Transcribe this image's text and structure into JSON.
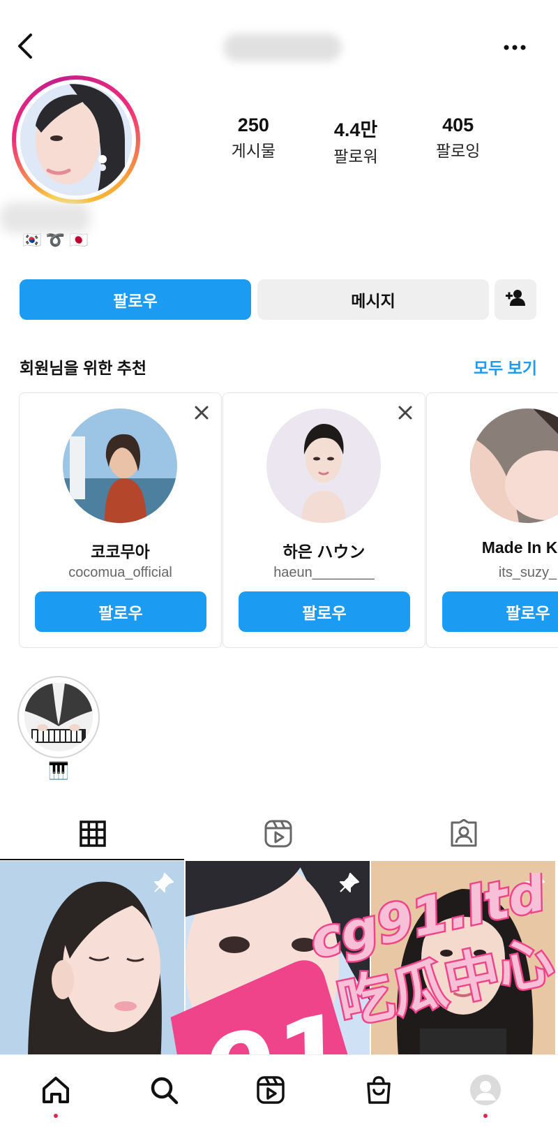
{
  "header": {
    "back_icon": "chevron-left-icon",
    "more_icon": "more-horizontal-icon"
  },
  "profile": {
    "stats": [
      {
        "value": "250",
        "label": "게시물"
      },
      {
        "value": "4.4만",
        "label": "팔로워"
      },
      {
        "value": "405",
        "label": "팔로잉"
      }
    ],
    "bio": "🇰🇷 ➰ 🇯🇵",
    "story_ring_colors": [
      "#f9ce34",
      "#ee2a7b",
      "#c51f8b"
    ]
  },
  "actions": {
    "follow_label": "팔로우",
    "message_label": "메시지",
    "add_user_icon": "person-plus-icon",
    "accent_color": "#1c9bf3"
  },
  "suggestions": {
    "title": "회원님을 위한 추천",
    "see_all_label": "모두 보기",
    "cards": [
      {
        "name": "코코무아",
        "username": "cocomua_official",
        "follow_label": "팔로우"
      },
      {
        "name": "하은 ハウン",
        "username": "haeun________",
        "follow_label": "팔로우"
      },
      {
        "name": "Made In Kor",
        "username": "its_suzy_",
        "follow_label": "팔로우"
      }
    ]
  },
  "highlights": [
    {
      "label": "🎹"
    }
  ],
  "tabs": [
    {
      "name": "grid-icon",
      "active": true
    },
    {
      "name": "reels-icon",
      "active": false
    },
    {
      "name": "tagged-icon",
      "active": false
    }
  ],
  "watermark": {
    "number": "91",
    "domain": "cg91.ltd",
    "text": "吃瓜中心",
    "color": "#f0448a"
  },
  "bottom_nav": [
    "home-icon",
    "search-icon",
    "reels-icon",
    "shop-icon",
    "profile-avatar"
  ]
}
